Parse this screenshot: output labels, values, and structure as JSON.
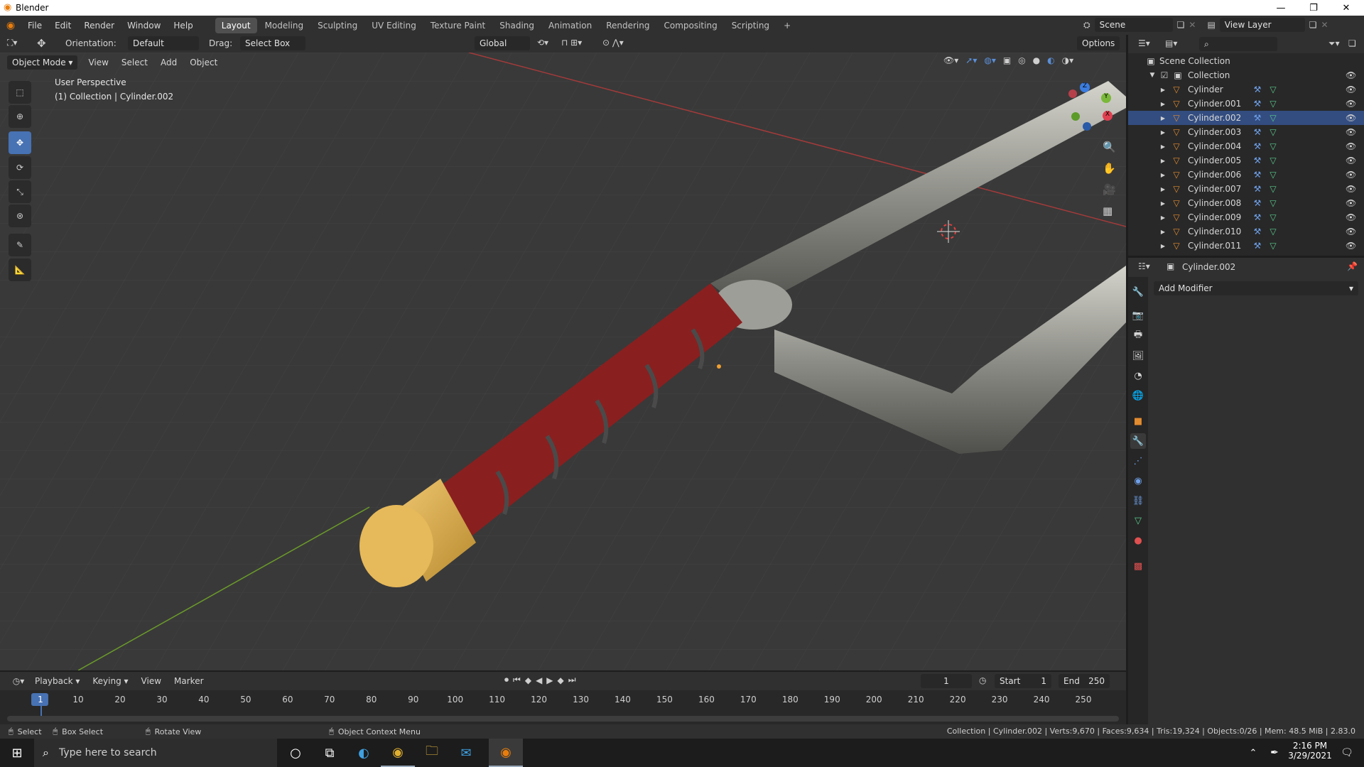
{
  "window": {
    "title": "Blender",
    "minimize": "—",
    "restore": "❐",
    "close": "✕"
  },
  "menu": [
    "File",
    "Edit",
    "Render",
    "Window",
    "Help"
  ],
  "workspaces": [
    "Layout",
    "Modeling",
    "Sculpting",
    "UV Editing",
    "Texture Paint",
    "Shading",
    "Animation",
    "Rendering",
    "Compositing",
    "Scripting"
  ],
  "add_workspace": "+",
  "scene": {
    "label": "Scene",
    "view_layer": "View Layer"
  },
  "tool_header": {
    "orientation_label": "Orientation:",
    "orientation_value": "Default",
    "drag_label": "Drag:",
    "drag_value": "Select Box",
    "transform_orientation": "Global",
    "options": "Options"
  },
  "viewport_header": {
    "mode": "Object Mode",
    "view": "View",
    "select": "Select",
    "add": "Add",
    "object": "Object"
  },
  "viewport": {
    "perspective": "User Perspective",
    "collection_info": "(1) Collection | Cylinder.002"
  },
  "gizmo": {
    "z": "Z",
    "y": "Y",
    "x": "X"
  },
  "outliner": {
    "scene_collection": "Scene Collection",
    "collection": "Collection",
    "objects": [
      "Cylinder",
      "Cylinder.001",
      "Cylinder.002",
      "Cylinder.003",
      "Cylinder.004",
      "Cylinder.005",
      "Cylinder.006",
      "Cylinder.007",
      "Cylinder.008",
      "Cylinder.009",
      "Cylinder.010",
      "Cylinder.011"
    ],
    "selected": "Cylinder.002"
  },
  "properties": {
    "object_name": "Cylinder.002",
    "add_modifier": "Add Modifier"
  },
  "timeline": {
    "playback": "Playback",
    "keying": "Keying",
    "view": "View",
    "marker": "Marker",
    "current_frame": "1",
    "start_label": "Start",
    "start": "1",
    "end_label": "End",
    "end": "250",
    "ticks": [
      "1",
      "10",
      "20",
      "30",
      "40",
      "50",
      "60",
      "70",
      "80",
      "90",
      "100",
      "110",
      "120",
      "130",
      "140",
      "150",
      "160",
      "170",
      "180",
      "190",
      "200",
      "210",
      "220",
      "230",
      "240",
      "250"
    ]
  },
  "statusbar": {
    "select": "Select",
    "box_select": "Box Select",
    "rotate_view": "Rotate View",
    "context_menu": "Object Context Menu",
    "stats": "Collection | Cylinder.002 | Verts:9,670 | Faces:9,634 | Tris:19,324 | Objects:0/26 | Mem: 48.5 MiB | 2.83.0"
  },
  "taskbar": {
    "search_placeholder": "Type here to search",
    "time": "2:16 PM",
    "date": "3/29/2021"
  },
  "colors": {
    "accent": "#4772b3",
    "selection": "#334d80",
    "object_orange": "#e38b2f",
    "mesh_green": "#59c98b"
  }
}
